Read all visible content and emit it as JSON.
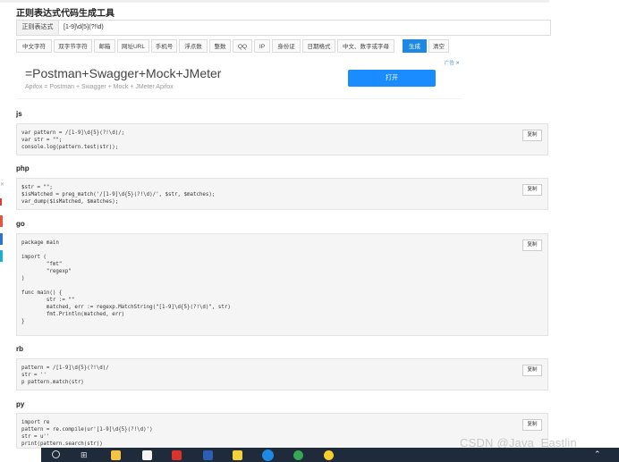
{
  "page_title": "正则表达式代码生成工具",
  "regex": {
    "label": "正则表达式",
    "value": "[1-9]\\d{5}(?!\\d)"
  },
  "buttons": [
    "中文字符",
    "双字节字符",
    "邮箱",
    "网址URL",
    "手机号",
    "浮点数",
    "整数",
    "QQ",
    "IP",
    "身份证",
    "日期格式",
    "中文、数字或字母",
    "生成",
    "清空"
  ],
  "ad": {
    "title": "=Postman+Swagger+Mock+JMeter",
    "subtitle": "Apifox = Postman + Swagger + Mock + JMeter Apifox",
    "open_button": "打开",
    "corner": "广告"
  },
  "copy_label": "复制",
  "sections": [
    {
      "lang": "js",
      "code": "var pattern = /[1-9]\\d{5}(?!\\d)/;\nvar str = \"\";\nconsole.log(pattern.test(str));"
    },
    {
      "lang": "php",
      "code": "$str = \"\";\n$isMatched = preg_match('/[1-9]\\d{5}(?!\\d)/', $str, $matches);\nvar_dump($isMatched, $matches);"
    },
    {
      "lang": "go",
      "code": "package main\n\nimport (\n        \"fmt\"\n        \"regexp\"\n)\n\nfunc main() {\n        str := \"\"\n        matched, err := regexp.MatchString(\"[1-9]\\d{5}(?!\\d)\", str)\n        fmt.Println(matched, err)\n}"
    },
    {
      "lang": "rb",
      "code": "pattern = /[1-9]\\d{5}(?!\\d)/\nstr = ''\np pattern.match(str)"
    },
    {
      "lang": "py",
      "code": "import re\npattern = re.compile(ur'[1-9]\\d{5}(?!\\d)')\nstr = u''\nprint(pattern.search(str))"
    }
  ],
  "watermark": "CSDN @Java_Eastlin",
  "taskbar_icons": [
    "search-icon",
    "task-view-icon",
    "file-explorer-icon",
    "typora-icon",
    "wps-icon",
    "word-icon",
    "notes-icon",
    "browser-icon",
    "chrome-icon",
    "app-icon"
  ]
}
